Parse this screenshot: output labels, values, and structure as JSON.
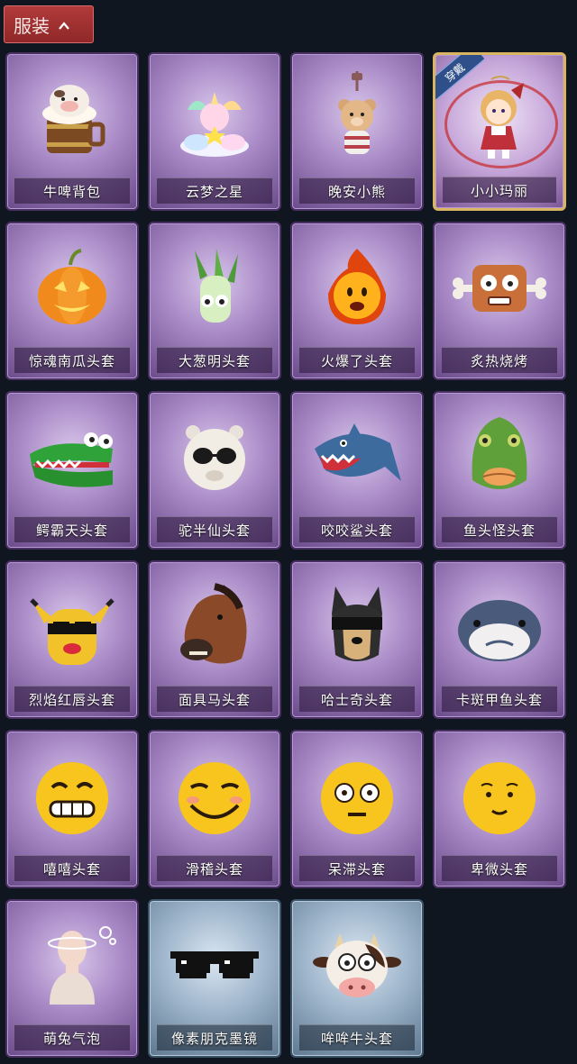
{
  "header": {
    "title": "服装"
  },
  "items": [
    {
      "label": "牛啤背包",
      "variant": "purple",
      "equipped": false
    },
    {
      "label": "云梦之星",
      "variant": "purple",
      "equipped": false
    },
    {
      "label": "晚安小熊",
      "variant": "purple",
      "equipped": false
    },
    {
      "label": "小小玛丽",
      "variant": "purple",
      "equipped": true,
      "badge": "穿戴"
    },
    {
      "label": "惊魂南瓜头套",
      "variant": "purple",
      "equipped": false
    },
    {
      "label": "大葱明头套",
      "variant": "purple",
      "equipped": false
    },
    {
      "label": "火爆了头套",
      "variant": "purple",
      "equipped": false
    },
    {
      "label": "炙热烧烤",
      "variant": "purple",
      "equipped": false
    },
    {
      "label": "鳄霸天头套",
      "variant": "purple",
      "equipped": false
    },
    {
      "label": "驼半仙头套",
      "variant": "purple",
      "equipped": false
    },
    {
      "label": "咬咬鲨头套",
      "variant": "purple",
      "equipped": false
    },
    {
      "label": "鱼头怪头套",
      "variant": "purple",
      "equipped": false
    },
    {
      "label": "烈焰红唇头套",
      "variant": "purple",
      "equipped": false
    },
    {
      "label": "面具马头套",
      "variant": "purple",
      "equipped": false
    },
    {
      "label": "哈士奇头套",
      "variant": "purple",
      "equipped": false
    },
    {
      "label": "卡斑甲鱼头套",
      "variant": "purple",
      "equipped": false
    },
    {
      "label": "嘻嘻头套",
      "variant": "purple",
      "equipped": false
    },
    {
      "label": "滑稽头套",
      "variant": "purple",
      "equipped": false
    },
    {
      "label": "呆滞头套",
      "variant": "purple",
      "equipped": false
    },
    {
      "label": "卑微头套",
      "variant": "purple",
      "equipped": false
    },
    {
      "label": "萌兔气泡",
      "variant": "purple",
      "equipped": false
    },
    {
      "label": "像素朋克墨镜",
      "variant": "blue",
      "equipped": false
    },
    {
      "label": "哞哞牛头套",
      "variant": "blue",
      "equipped": false
    }
  ]
}
